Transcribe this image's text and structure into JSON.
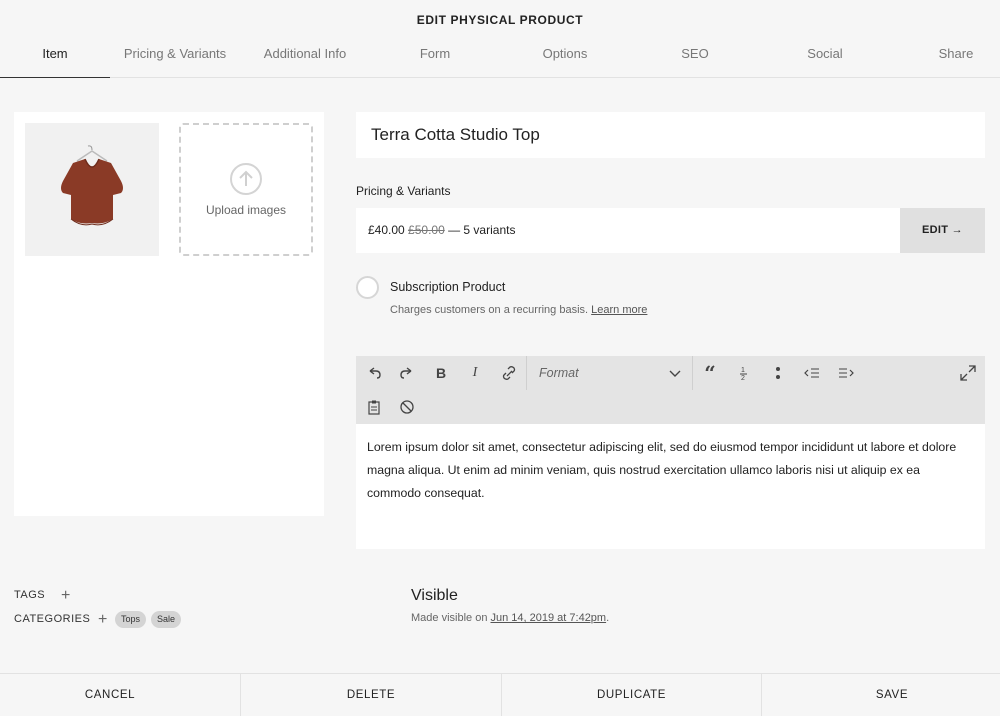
{
  "header": {
    "title": "EDIT PHYSICAL PRODUCT"
  },
  "tabs": [
    {
      "label": "Item"
    },
    {
      "label": "Pricing & Variants"
    },
    {
      "label": "Additional Info"
    },
    {
      "label": "Form"
    },
    {
      "label": "Options"
    },
    {
      "label": "SEO"
    },
    {
      "label": "Social"
    },
    {
      "label": "Share"
    }
  ],
  "images": {
    "upload_label": "Upload images"
  },
  "product": {
    "title": "Terra Cotta Studio Top"
  },
  "pricing": {
    "section_label": "Pricing & Variants",
    "price": "£40.00",
    "original_price": "£50.00",
    "variants": "— 5 variants",
    "edit_label": "EDIT →"
  },
  "subscription": {
    "title": "Subscription Product",
    "description": "Charges customers on a recurring basis.",
    "learn_more": "Learn more"
  },
  "toolbar": {
    "format_placeholder": "Format"
  },
  "description": {
    "text": "Lorem ipsum dolor sit amet, consectetur adipiscing elit, sed do eiusmod tempor incididunt ut labore et dolore magna aliqua. Ut enim ad minim veniam, quis nostrud exercitation ullamco laboris nisi ut aliquip ex ea commodo consequat."
  },
  "meta": {
    "tags_label": "TAGS",
    "categories_label": "CATEGORIES",
    "categories": [
      "Tops",
      "Sale"
    ]
  },
  "visibility": {
    "title": "Visible",
    "prefix": "Made visible on",
    "date": "Jun 14, 2019 at 7:42pm",
    "suffix": "."
  },
  "footer": {
    "cancel": "CANCEL",
    "delete": "DELETE",
    "duplicate": "DUPLICATE",
    "save": "SAVE"
  },
  "colors": {
    "accent_text": "#222222",
    "muted_text": "#777777",
    "shirt": "#8a3a26"
  }
}
